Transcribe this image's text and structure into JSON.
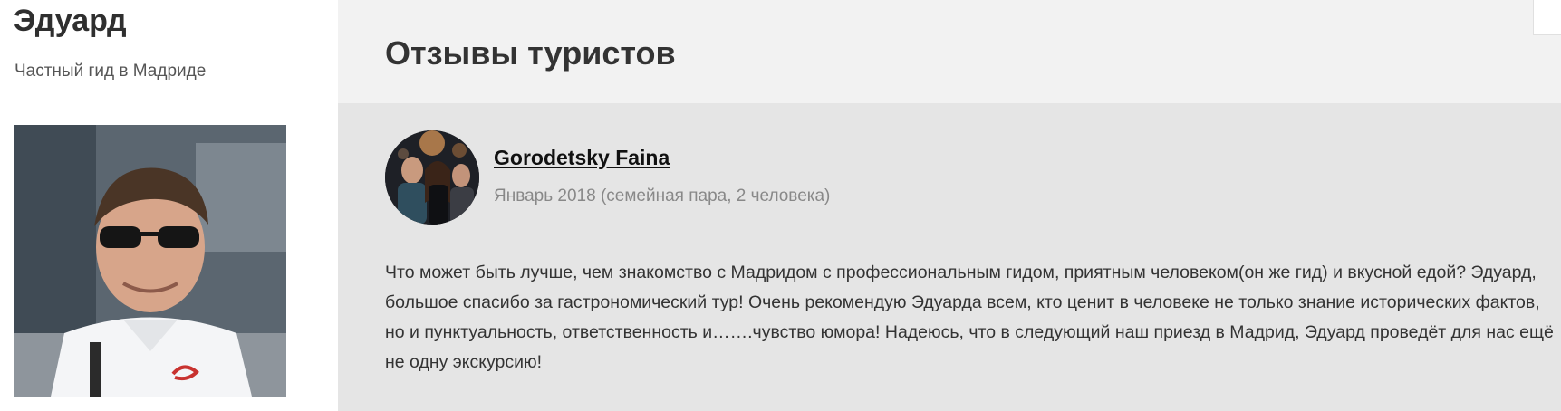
{
  "guide": {
    "name": "Эдуард",
    "subtitle": "Частный гид в Мадриде"
  },
  "reviews_section": {
    "title": "Отзывы туристов"
  },
  "review": {
    "author": "Gorodetsky Faina",
    "meta": "Январь 2018 (семейная пара, 2 человека)",
    "text": "Что может быть лучше, чем знакомство с Мадридом с профессиональным гидом, приятным человеком(он же гид) и вкусной едой? Эдуард, большое спасибо за гастрономический тур! Очень рекомендую Эдуарда всем, кто ценит в человеке не только знание исторических фактов, но и пунктуальность, ответственность и…….чувство юмора! Надеюсь, что в следующий наш приезд в Мадрид, Эдуард проведёт для нас ещё не одну экскурсию!"
  }
}
